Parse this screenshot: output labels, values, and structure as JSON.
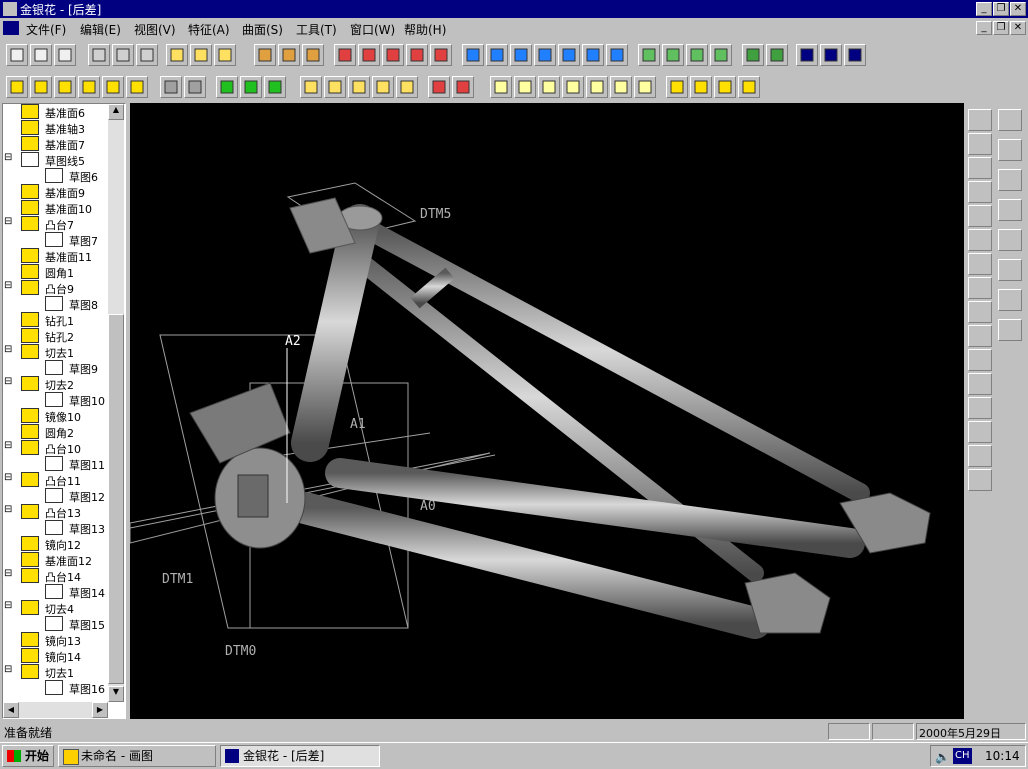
{
  "title_bar": {
    "title": "金银花 - [后差]"
  },
  "menu": [
    "文件(F)",
    "编辑(E)",
    "视图(V)",
    "特征(A)",
    "曲面(S)",
    "工具(T)",
    "窗口(W)",
    "帮助(H)"
  ],
  "tree": [
    {
      "label": "基准面6",
      "icon": "datum-plane-icon",
      "level": 1
    },
    {
      "label": "基准轴3",
      "icon": "datum-axis-icon",
      "level": 1
    },
    {
      "label": "基准面7",
      "icon": "datum-plane-icon",
      "level": 1
    },
    {
      "label": "草图线5",
      "icon": "sketch-curve-icon",
      "level": 0
    },
    {
      "label": "草图6",
      "icon": "sketch-icon",
      "level": 2
    },
    {
      "label": "基准面9",
      "icon": "datum-plane-icon",
      "level": 1
    },
    {
      "label": "基准面10",
      "icon": "datum-plane-icon",
      "level": 1
    },
    {
      "label": "凸台7",
      "icon": "boss-icon",
      "level": 0
    },
    {
      "label": "草图7",
      "icon": "sketch-icon",
      "level": 2
    },
    {
      "label": "基准面11",
      "icon": "datum-plane-icon",
      "level": 1
    },
    {
      "label": "圆角1",
      "icon": "fillet-icon",
      "level": 1
    },
    {
      "label": "凸台9",
      "icon": "boss-icon",
      "level": 0
    },
    {
      "label": "草图8",
      "icon": "sketch-icon",
      "level": 2
    },
    {
      "label": "钻孔1",
      "icon": "hole-icon",
      "level": 1
    },
    {
      "label": "钻孔2",
      "icon": "hole-icon",
      "level": 1
    },
    {
      "label": "切去1",
      "icon": "cut-icon",
      "level": 0
    },
    {
      "label": "草图9",
      "icon": "sketch-icon",
      "level": 2
    },
    {
      "label": "切去2",
      "icon": "cut-icon",
      "level": 0
    },
    {
      "label": "草图10",
      "icon": "sketch-icon",
      "level": 2
    },
    {
      "label": "镜像10",
      "icon": "mirror-icon",
      "level": 1
    },
    {
      "label": "圆角2",
      "icon": "fillet-icon",
      "level": 1
    },
    {
      "label": "凸台10",
      "icon": "boss-icon",
      "level": 0
    },
    {
      "label": "草图11",
      "icon": "sketch-icon",
      "level": 2
    },
    {
      "label": "凸台11",
      "icon": "boss-icon",
      "level": 0
    },
    {
      "label": "草图12",
      "icon": "sketch-icon",
      "level": 2
    },
    {
      "label": "凸台13",
      "icon": "boss-icon",
      "level": 0
    },
    {
      "label": "草图13",
      "icon": "sketch-icon",
      "level": 2
    },
    {
      "label": "镜向12",
      "icon": "mirror-icon",
      "level": 1
    },
    {
      "label": "基准面12",
      "icon": "datum-plane-icon",
      "level": 1
    },
    {
      "label": "凸台14",
      "icon": "boss-icon",
      "level": 0
    },
    {
      "label": "草图14",
      "icon": "sketch-icon",
      "level": 2
    },
    {
      "label": "切去4",
      "icon": "cut-icon",
      "level": 0
    },
    {
      "label": "草图15",
      "icon": "sketch-icon",
      "level": 2
    },
    {
      "label": "镜向13",
      "icon": "mirror-icon",
      "level": 1
    },
    {
      "label": "镜向14",
      "icon": "mirror-icon",
      "level": 1
    },
    {
      "label": "切去1",
      "icon": "cut-icon",
      "level": 0
    },
    {
      "label": "草图16",
      "icon": "sketch-icon",
      "level": 2
    }
  ],
  "viewport_labels": {
    "dtm5": "DTM5",
    "a2": "A2",
    "a1": "A1",
    "a0": "A0",
    "dtm1": "DTM1",
    "dtm0": "DTM0"
  },
  "status": {
    "text": "准备就绪",
    "date": "2000年5月29日"
  },
  "taskbar": {
    "start": "开始",
    "task1": "未命名 - 画图",
    "task2": "金银花 - [后差]",
    "ime": "CH",
    "clock": "10:14"
  },
  "colors": {
    "title": "#000080",
    "face": "#c0c0c0",
    "viewport": "#000000",
    "model": "#8c8c8c"
  }
}
